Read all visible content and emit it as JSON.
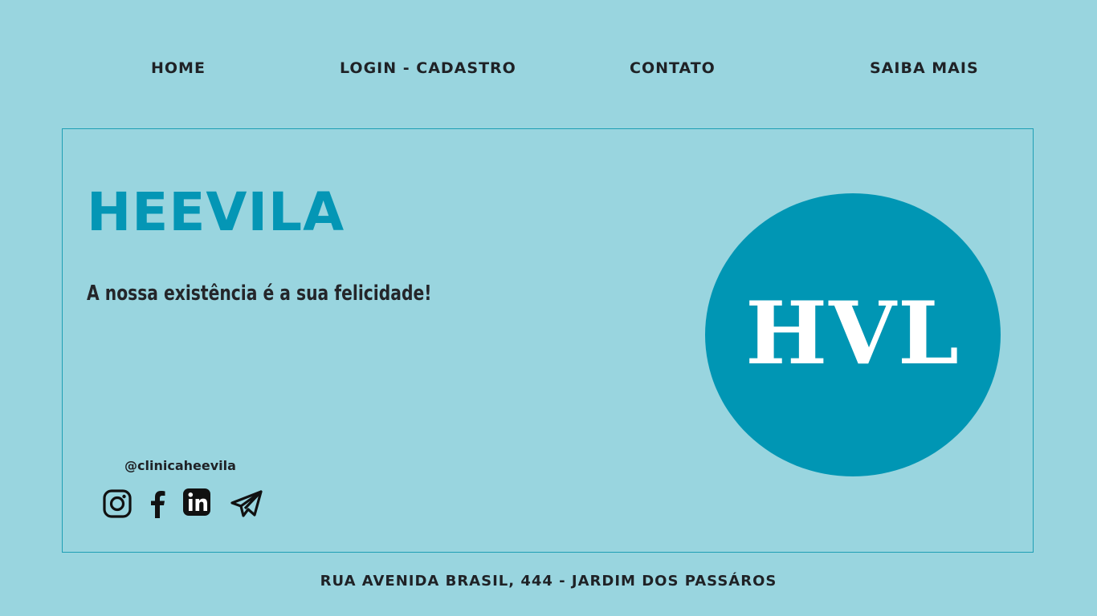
{
  "nav": {
    "home": "HOME",
    "login": "LOGIN - CADASTRO",
    "contato": "CONTATO",
    "saiba_mais": "SAIBA MAIS"
  },
  "hero": {
    "title": "HEEVILA",
    "tagline": "A nossa existência é a sua felicidade!",
    "handle": "@clinicaheevila"
  },
  "social": {
    "icons": [
      "instagram-icon",
      "facebook-icon",
      "linkedin-icon",
      "telegram-icon"
    ]
  },
  "logo": {
    "text": "HVL"
  },
  "footer": {
    "address": "RUA AVENIDA BRASIL, 444 - JARDIM DOS PASSÁROS"
  },
  "colors": {
    "background": "#99d5df",
    "accent": "#0096b4",
    "text": "#1f2226",
    "logo_text": "#ffffff"
  }
}
